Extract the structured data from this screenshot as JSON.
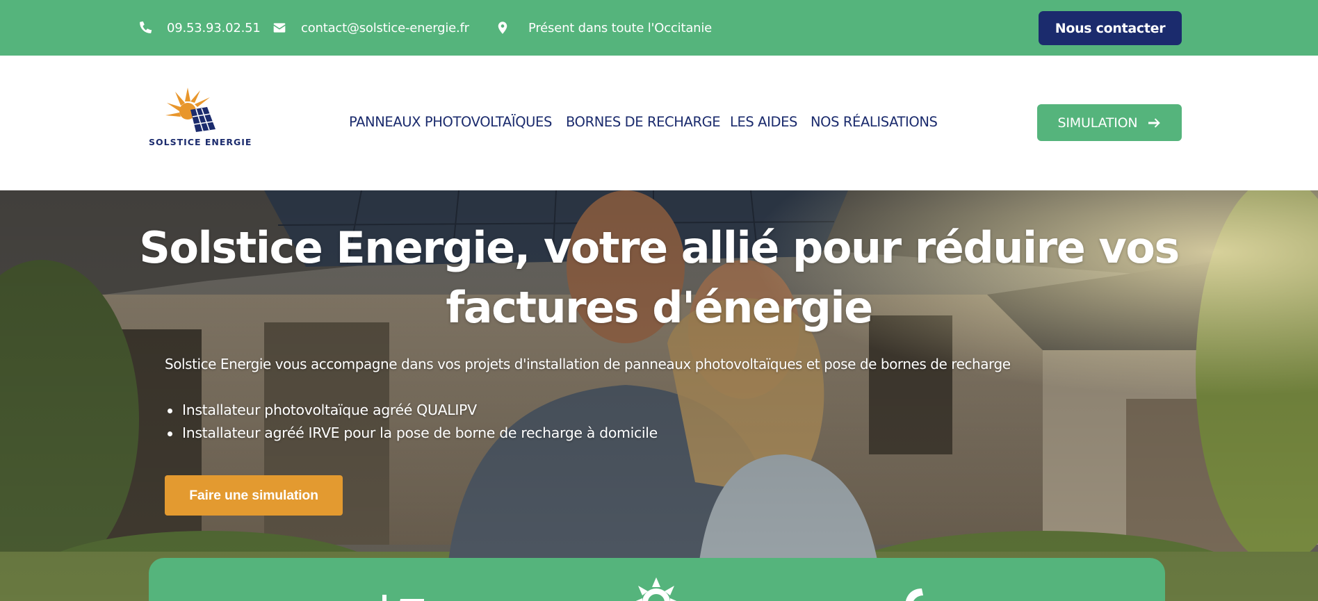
{
  "topbar": {
    "phone": "09.53.93.02.51",
    "email": "contact@solstice-energie.fr",
    "location": "Présent dans toute l'Occitanie",
    "contact_button": "Nous contacter"
  },
  "header": {
    "logo_text": "SOLSTICE ENERGIE",
    "nav": [
      {
        "label": "PANNEAUX PHOTOVOLTAÏQUES"
      },
      {
        "label": "BORNES DE RECHARGE"
      },
      {
        "label": "LES AIDES"
      },
      {
        "label": "NOS RÉALISATIONS"
      }
    ],
    "simulation_button": "SIMULATION"
  },
  "hero": {
    "title": "Solstice Energie, votre allié pour réduire vos factures d'énergie",
    "subtitle": "Solstice Energie vous accompagne dans vos projets d'installation de panneaux photovoltaïques et pose de bornes de recharge",
    "bullets": [
      "Installateur photovoltaïque agréé QUALIPV",
      "Installateur agréé IRVE pour la pose de borne de recharge à domicile"
    ],
    "cta": "Faire une simulation"
  },
  "icons": {
    "phone": "phone-icon",
    "email": "envelope-icon",
    "location": "map-pin-icon",
    "arrow": "arrow-right-icon",
    "card": [
      "solar-panel-icon",
      "sun-icon",
      "charging-icon"
    ]
  },
  "colors": {
    "brand_green": "#55b47c",
    "navy": "#1b2b6d",
    "orange": "#e39a30",
    "white": "#ffffff"
  }
}
